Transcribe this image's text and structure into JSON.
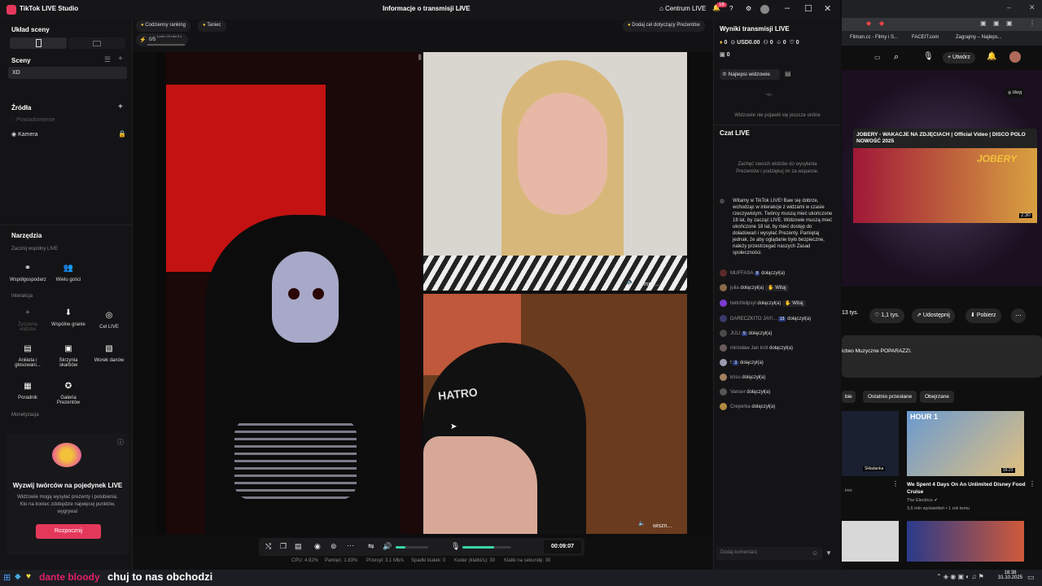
{
  "titlebar": {
    "app_name": "TikTok LIVE Studio",
    "center_title": "Informacje o transmisji LIVE",
    "center_link": "Centrum LIVE",
    "notif_count": "16"
  },
  "left": {
    "layout_title": "Układ sceny",
    "scenes_title": "Sceny",
    "scene_item": "XD",
    "sources_title": "Źródła",
    "sources": [
      "Powiadomienie",
      "Kamera"
    ],
    "tools_title": "Narzędzia",
    "joint_live_title": "Zacznij wspólny LIVE",
    "joint_tools": [
      "Współgospodarz",
      "Wielu gości"
    ],
    "interaction_title": "Interakcja",
    "interaction_tools": [
      "Życzenia widzów",
      "Wspólne granie",
      "Cel LIVE",
      "Ankieta i głosowani...",
      "Skrzynia skarbów",
      "Worek danów",
      "Poradnik",
      "Galeria Prezentów"
    ],
    "monetization_title": "Monetyzacja",
    "promo_title": "Wyzwij twórców na pojedynek LIVE",
    "promo_text": "Widzowie mogą wysyłać prezenty i polubienia. Kto na koniec zdobędzie najwięcej punktów, wygrywa!",
    "promo_button": "Rozpocznij"
  },
  "topbar": {
    "pill_ranking": "Codzienny ranking",
    "pill_dance": "Taniec",
    "goal_text": "0/5",
    "goal_sub": "Lovin: 15 min 0 s",
    "gift_goal": "Dodaj cel dotyczący Prezentów"
  },
  "feeds": {
    "tr_name": "Empir...",
    "br_name": "wiszn..."
  },
  "controls": {
    "timer": "00:09:07",
    "mic_level": 0.65,
    "speaker_level": 0.3
  },
  "stats": {
    "cpu": "CPU: 4.92%",
    "mem": "Pamięć: 1.83%",
    "bitrate": "Przesył: 3.1 Mb/s",
    "dropped": "Spadki klatek: 0",
    "encoder": "Koder (klatki/s): 30",
    "fps": "Klatki na sekundę: 30"
  },
  "right": {
    "results_title": "Wyniki transmisji LIVE",
    "stat_coins": "0",
    "stat_usd": "USD0.00",
    "stat_viewers": "0",
    "stat_likes": "0",
    "stat_hearts": "0",
    "stat_gifts": "0",
    "top_viewers_tab": "Najlepsi widzowie",
    "no_viewers": "Widzowie nie pojawili się jeszcze online",
    "chat_title": "Czat LIVE",
    "chat_hint": "Zachęć swoich widzów do wysyłania Prezentów i podziękuj im za wsparcie.",
    "welcome": "Witamy w TikTok LIVE! Baw się dobrze, wchodząc w interakcje z widzami w czasie rzeczywistym. Twórcy muszą mieć ukończone 18 lat, by zacząć LIVE. Widzowie muszą mieć ukończone 18 lat, by mieć dostęp do doładowań i wysyłać Prezenty. Pamiętaj jednak, że aby oglądanie było bezpieczne, należy przestrzegać naszych Zasad społeczności.",
    "joined": "dołączył(a)",
    "welcome_btn": "Witaj",
    "chat_users": [
      "MUFFASA",
      "julia",
      "twitchkilpsyl",
      "DARECZKITO JA!!!...",
      "JULI",
      "mirosław Jan król",
      "f",
      "krisu",
      "Vanser",
      "Creperka"
    ],
    "chip_values": [
      "8",
      "13",
      "5",
      "3"
    ],
    "comment_placeholder": "Dodaj komentarz"
  },
  "browser": {
    "tabs": [
      "Filman.cc - Filmy i S...",
      "FACEIT.com",
      "Zagrajmy – Najleps..."
    ],
    "create": "Utwórz",
    "hide": "Ukryj",
    "ad_title": "JOBERY - WAKACJE NA ZDJĘCIACH | Official Video | DISCO POLO NOWOŚĆ 2025",
    "ad_duration": "2:30",
    "likes": "13 tys.",
    "dislikes": "1,1 tys.",
    "share": "Udostępnij",
    "download": "Pobierz",
    "channel_desc": "ictwo Muzyczne POPARAZZI.",
    "filter_1": "bie",
    "filter_2": "Ostatnio przesłane",
    "filter_3": "Obejrzane",
    "sklej": "Składanka",
    "rec_title": "We Spent 4 Days On An Unlimited Disney Food Cruise",
    "rec_channel": "The Electrics",
    "rec_meta": "3,6 mln wyświetleń • 1 rok temu",
    "rec_duration": "16:23",
    "rec_small": "inni",
    "thumb_text": "HOUR 1"
  },
  "taskbar": {
    "chat_overlay_1": "dante bloody",
    "chat_overlay_2": "chuj to nas obchodzi",
    "time": "18:38",
    "date": "31.10.2025"
  }
}
